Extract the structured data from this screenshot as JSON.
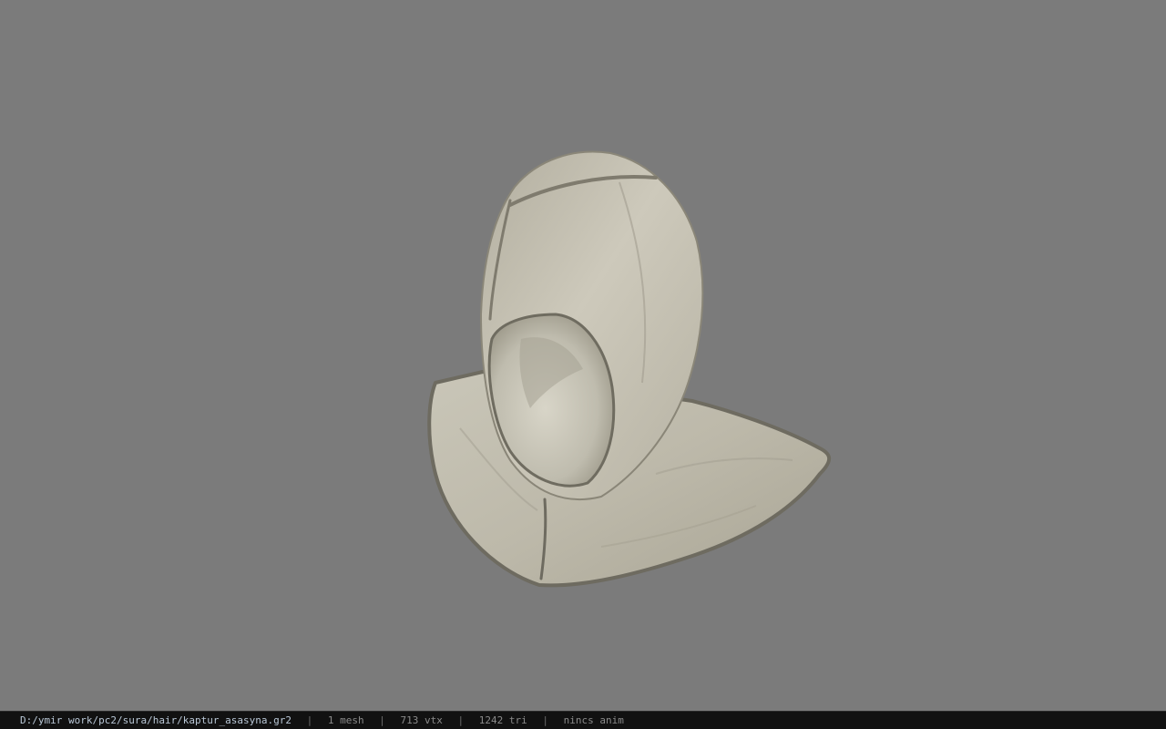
{
  "viewer": {
    "background_color": "#7b7b7b",
    "model_description_icon": "hood-mesh-icon"
  },
  "status": {
    "file_path": "D:/ymir work/pc2/sura/hair/kaptur_asasyna.gr2",
    "separator": "|",
    "mesh_count": "1 mesh",
    "vertex_count": "713 vtx",
    "triangle_count": "1242 tri",
    "animation": "nincs anim"
  }
}
